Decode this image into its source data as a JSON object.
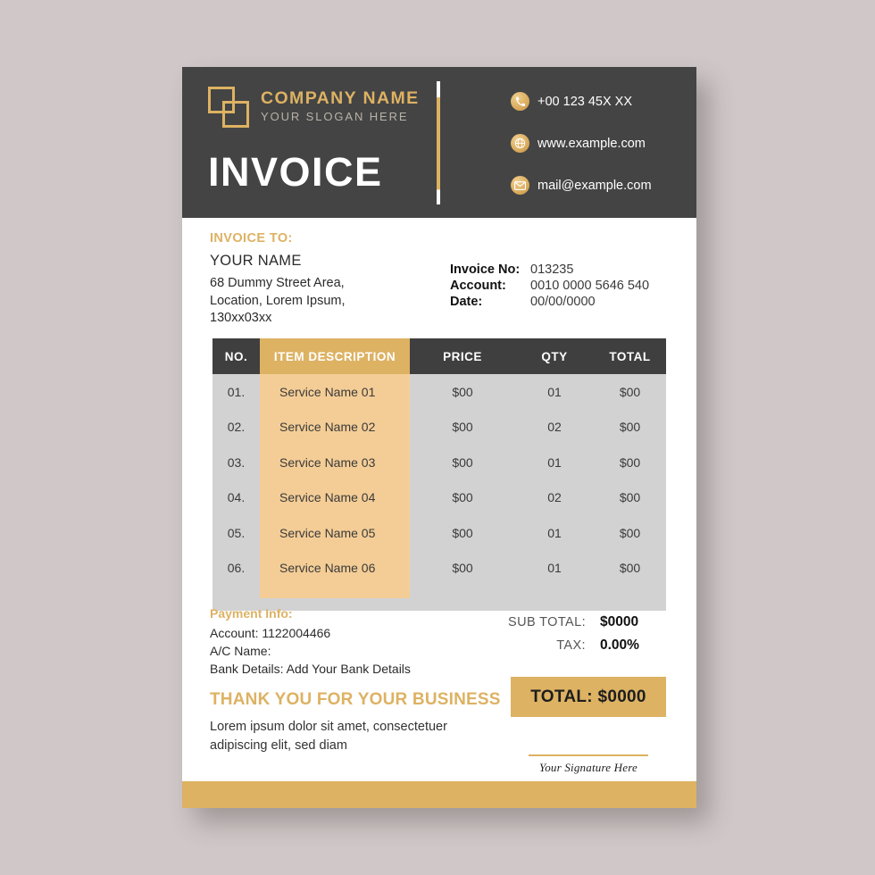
{
  "theme": {
    "gold": "#ddb263",
    "dark": "#444444",
    "table_body_bg": "#d2d2d2",
    "desc_col_bg": "#f4cd96",
    "page_bg": "#d0c8c8"
  },
  "header": {
    "logo_icon": "two-overlapping-squares-logo",
    "company_name": "COMPANY NAME",
    "slogan": "YOUR SLOGAN HERE",
    "document_title": "INVOICE",
    "contacts": [
      {
        "icon": "phone-icon",
        "text": "+00 123 45X XX"
      },
      {
        "icon": "globe-icon",
        "text": "www.example.com"
      },
      {
        "icon": "envelope-icon",
        "text": "mail@example.com"
      }
    ]
  },
  "bill_to": {
    "title": "INVOICE TO:",
    "name": "YOUR NAME",
    "address_line1": "68 Dummy Street Area,",
    "address_line2": "Location, Lorem Ipsum,",
    "address_line3": "130xx03xx"
  },
  "invoice_meta": [
    {
      "label": "Invoice No:",
      "value": "013235"
    },
    {
      "label": "Account:",
      "value": "0010 0000 5646 540"
    },
    {
      "label": "Date:",
      "value": "00/00/0000"
    }
  ],
  "table": {
    "columns": [
      "NO.",
      "ITEM DESCRIPTION",
      "PRICE",
      "QTY",
      "TOTAL"
    ],
    "rows": [
      {
        "no": "01.",
        "description": "Service Name 01",
        "price": "$00",
        "qty": "01",
        "total": "$00"
      },
      {
        "no": "02.",
        "description": "Service Name 02",
        "price": "$00",
        "qty": "02",
        "total": "$00"
      },
      {
        "no": "03.",
        "description": "Service Name 03",
        "price": "$00",
        "qty": "01",
        "total": "$00"
      },
      {
        "no": "04.",
        "description": "Service Name 04",
        "price": "$00",
        "qty": "02",
        "total": "$00"
      },
      {
        "no": "05.",
        "description": "Service Name 05",
        "price": "$00",
        "qty": "01",
        "total": "$00"
      },
      {
        "no": "06.",
        "description": "Service Name 06",
        "price": "$00",
        "qty": "01",
        "total": "$00"
      }
    ]
  },
  "payment_info": {
    "title": "Payment Info:",
    "account": "Account: 1122004466",
    "ac_name": "A/C Name:",
    "bank_details": "Bank Details: Add Your Bank Details"
  },
  "totals": {
    "sub_total_label": "SUB TOTAL:",
    "sub_total_value": "$0000",
    "tax_label": "TAX:",
    "tax_value": "0.00%",
    "total_box": "TOTAL: $0000"
  },
  "thank_you": {
    "title": "THANK YOU FOR YOUR BUSINESS",
    "line1": "Lorem ipsum dolor sit amet, consectetuer",
    "line2": "adipiscing elit, sed diam"
  },
  "signature": {
    "text": "Your Signature Here"
  }
}
